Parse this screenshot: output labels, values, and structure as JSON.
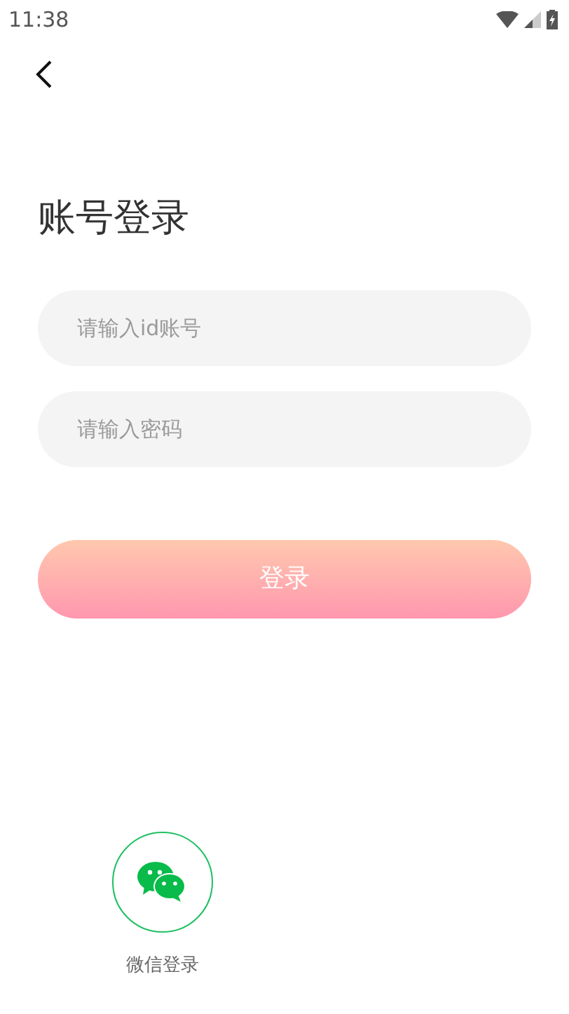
{
  "status_bar": {
    "time": "11:38"
  },
  "title": "账号登录",
  "fields": [
    {
      "placeholder": "请输入id账号"
    },
    {
      "placeholder": "请输入密码"
    }
  ],
  "login_button": "登录",
  "social_login": {
    "label": "微信登录"
  }
}
